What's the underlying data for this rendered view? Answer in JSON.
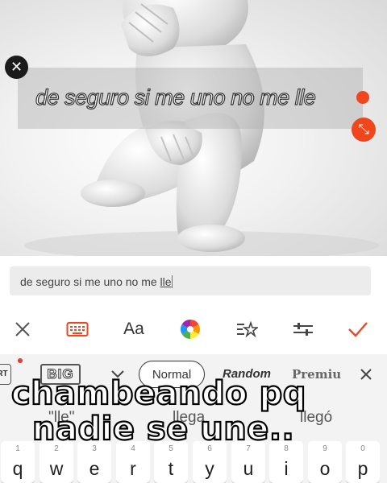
{
  "overlay": {
    "text": "de seguro si me uno no me lle",
    "accent_color": "#f0461e"
  },
  "icons": {
    "close_overlay": "close-icon",
    "resize": "resize-arrows-icon"
  },
  "input": {
    "value_before": "de seguro si me uno no me ",
    "value_underlined": "lle"
  },
  "toolbar": {
    "font_label": "Aa",
    "items": [
      "close-icon",
      "keyboard-icon",
      "font-icon",
      "color-wheel-icon",
      "text-effect-icon",
      "adjust-sliders-icon",
      "check-icon"
    ]
  },
  "keyboard": {
    "suggestions": {
      "art_label": "RT",
      "big_label": "BIG",
      "normal_label": "Normal",
      "random_label": "Random",
      "premium_label": "Premiu"
    },
    "predictions": [
      "\"lle\"",
      "llega",
      "llegó"
    ],
    "keys": [
      {
        "num": "1",
        "ch": "q"
      },
      {
        "num": "2",
        "ch": "w"
      },
      {
        "num": "3",
        "ch": "e"
      },
      {
        "num": "4",
        "ch": "r"
      },
      {
        "num": "5",
        "ch": "t"
      },
      {
        "num": "6",
        "ch": "y"
      },
      {
        "num": "7",
        "ch": "u"
      },
      {
        "num": "8",
        "ch": "i"
      },
      {
        "num": "9",
        "ch": "o"
      },
      {
        "num": "0",
        "ch": "p"
      }
    ]
  },
  "caption": {
    "line1": "chambeando pq",
    "line2": "nadie se une.."
  }
}
